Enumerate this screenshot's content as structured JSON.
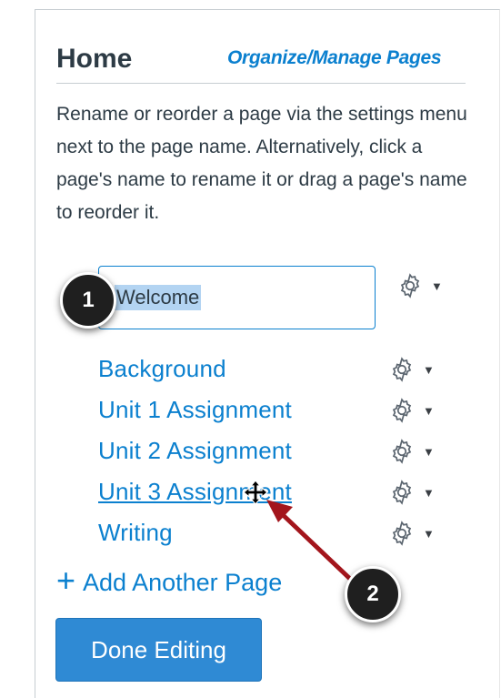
{
  "header": {
    "title": "Home",
    "organize_link": "Organize/Manage Pages"
  },
  "description": "Rename or reorder a page via the settings menu next to the page name. Alternatively, click a page's name to rename it or drag a page's name to reorder it.",
  "editing_page": {
    "value": "Welcome"
  },
  "pages": [
    {
      "label": "Background"
    },
    {
      "label": "Unit 1 Assignment"
    },
    {
      "label": "Unit 2 Assignment"
    },
    {
      "label": "Unit 3 Assignment"
    },
    {
      "label": "Writing"
    }
  ],
  "add_page_label": "Add Another Page",
  "done_button_label": "Done Editing",
  "callouts": [
    "1",
    "2"
  ],
  "icons": {
    "settings": "gear-icon",
    "menu_caret": "caret-down-icon",
    "move_cursor": "move-cursor-icon",
    "add": "plus-icon"
  },
  "colors": {
    "link": "#0b80cf",
    "button": "#2f8ad4",
    "selection": "#b3d4f2",
    "callout": "#1f1f1f",
    "arrow": "#a3151c"
  }
}
